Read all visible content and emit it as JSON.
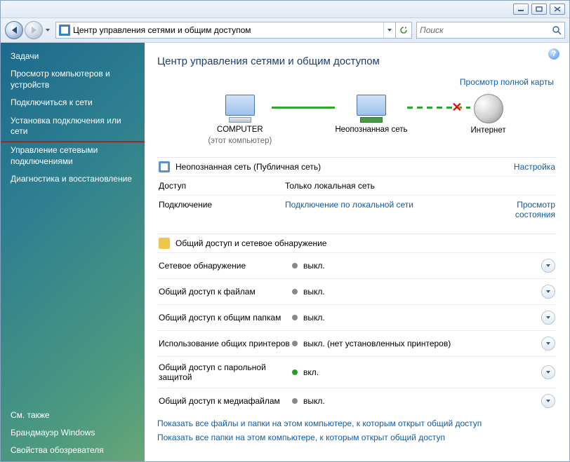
{
  "nav": {
    "address": "Центр управления сетями и общим доступом",
    "search_placeholder": "Поиск"
  },
  "sidebar": {
    "heading": "Задачи",
    "items": [
      "Просмотр компьютеров и устройств",
      "Подключиться к сети",
      "Установка подключения или сети",
      "Управление сетевыми подключениями",
      "Диагностика и восстановление"
    ],
    "see_also_heading": "См. также",
    "see_also": [
      "Брандмауэр Windows",
      "Свойства обозревателя"
    ]
  },
  "main": {
    "title": "Центр управления сетями и общим доступом",
    "full_map": "Просмотр полной карты"
  },
  "map": {
    "nodes": [
      {
        "label": "COMPUTER",
        "sub": "(этот компьютер)"
      },
      {
        "label": "Неопознанная сеть"
      },
      {
        "label": "Интернет"
      }
    ],
    "links": [
      "connected",
      "broken"
    ]
  },
  "network": {
    "name": "Неопознанная сеть (Публичная сеть)",
    "customize": "Настройка",
    "rows": [
      {
        "k": "Доступ",
        "v": "Только локальная сеть"
      },
      {
        "k": "Подключение",
        "v": "Подключение по локальной сети",
        "r": "Просмотр состояния"
      }
    ]
  },
  "sharing": {
    "title": "Общий доступ и сетевое обнаружение",
    "rows": [
      {
        "k": "Сетевое обнаружение",
        "v": "выкл.",
        "state": "off"
      },
      {
        "k": "Общий доступ к файлам",
        "v": "выкл.",
        "state": "off"
      },
      {
        "k": "Общий доступ к общим папкам",
        "v": "выкл.",
        "state": "off"
      },
      {
        "k": "Использование общих принтеров",
        "v": "выкл. (нет установленных принтеров)",
        "state": "off"
      },
      {
        "k": "Общий доступ с парольной защитой",
        "v": "вкл.",
        "state": "on"
      },
      {
        "k": "Общий доступ к медиафайлам",
        "v": "выкл.",
        "state": "off"
      }
    ]
  },
  "footer": [
    "Показать все файлы и папки на этом компьютере, к которым открыт общий доступ",
    "Показать все папки на этом компьютере, к которым открыт общий доступ"
  ]
}
